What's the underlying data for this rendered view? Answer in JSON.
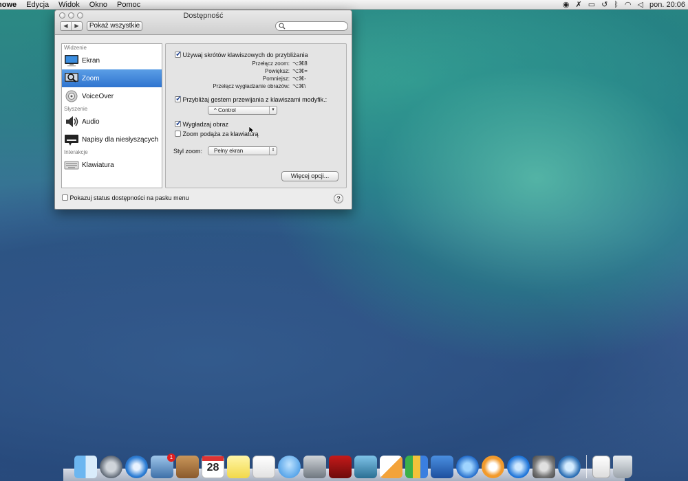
{
  "menubar": {
    "app_name": "nowe",
    "items": [
      "Edycja",
      "Widok",
      "Okno",
      "Pomoc"
    ],
    "clock": "pon. 20:06"
  },
  "window": {
    "title": "Dostępność",
    "show_all": "Pokaż wszystkie"
  },
  "sidebar": {
    "sections": [
      {
        "label": "Widzenie",
        "items": [
          {
            "label": "Ekran",
            "icon": "monitor-icon"
          },
          {
            "label": "Zoom",
            "icon": "zoom-icon",
            "selected": true
          },
          {
            "label": "VoiceOver",
            "icon": "voiceover-icon"
          }
        ]
      },
      {
        "label": "Słyszenie",
        "items": [
          {
            "label": "Audio",
            "icon": "speaker-icon"
          },
          {
            "label": "Napisy dla niesłyszących",
            "icon": "captions-icon"
          }
        ]
      },
      {
        "label": "Interakcje",
        "items": [
          {
            "label": "Klawiatura",
            "icon": "keyboard-icon"
          }
        ]
      }
    ]
  },
  "panel": {
    "use_shortcuts": {
      "label": "Używaj skrótów klawiszowych do przybliżania",
      "checked": true
    },
    "shortcuts": [
      {
        "label": "Przełącz zoom:",
        "value": "⌥⌘8"
      },
      {
        "label": "Powiększ:",
        "value": "⌥⌘="
      },
      {
        "label": "Pomniejsz:",
        "value": "⌥⌘-"
      },
      {
        "label": "Przełącz wygładzanie obrazów:",
        "value": "⌥⌘\\"
      }
    ],
    "scroll_gesture": {
      "label": "Przybliżaj gestem przewijania z klawiszami modyfik.:",
      "checked": true
    },
    "modifier_select": "^ Control",
    "smooth_image": {
      "label": "Wygładzaj obraz",
      "checked": true
    },
    "follow_focus": {
      "label": "Zoom podąża za klawiaturą",
      "checked": false
    },
    "zoom_style_label": "Styl zoom:",
    "zoom_style_value": "Pełny ekran",
    "more_options": "Więcej opcji..."
  },
  "footer": {
    "status_checkbox": "Pokazuj status dostępności na pasku menu",
    "help": "?"
  },
  "dock": {
    "icons": [
      "finder-icon",
      "launchpad-icon",
      "safari-icon",
      "mail-icon",
      "contacts-icon",
      "calendar-icon",
      "notes-icon",
      "reminders-icon",
      "messages-icon",
      "facetime-icon",
      "photo-booth-icon",
      "iphoto-icon",
      "pages-icon",
      "numbers-icon",
      "keynote-icon",
      "itunes-icon",
      "ibooks-icon",
      "app-store-icon",
      "system-preferences-icon",
      "quicktime-icon",
      "document-icon",
      "trash-icon"
    ],
    "calendar_day": "28",
    "mail_badge": "1"
  }
}
